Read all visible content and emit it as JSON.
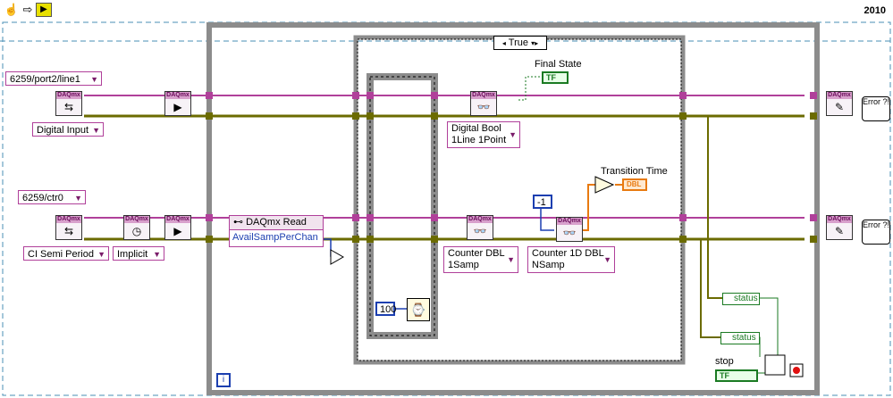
{
  "toolbar": {
    "icons": [
      "hand-icon",
      "arrow-right-icon",
      "run-arrow-icon"
    ],
    "version": "2010"
  },
  "diagram": {
    "case_selector": "True",
    "controls": {
      "line_channel": "6259/port2/line1",
      "ctr_channel": "6259/ctr0",
      "digital_input": "Digital Input",
      "ci_semi_period": "CI Semi Period",
      "implicit": "Implicit",
      "digital_bool_1": "Digital Bool",
      "digital_bool_2": "1Line 1Point",
      "counter_dbl_1": "Counter DBL",
      "counter_dbl_2": "1Samp",
      "counter_1d_dbl_1": "Counter 1D DBL",
      "counter_1d_dbl_2": "NSamp"
    },
    "read_node": {
      "title": "DAQmx Read",
      "property": "AvailSampPerChan"
    },
    "labels": {
      "final_state": "Final State",
      "transition_time": "Transition Time",
      "stop": "stop",
      "status_1": "status",
      "status_2": "status",
      "loop_index": "i"
    },
    "constants": {
      "wait_ms": "100",
      "minus_one": "-1"
    },
    "indicators": {
      "tf_final": "TF",
      "tf_stop": "TF",
      "dbl": "DBL"
    },
    "vi_labels": {
      "daqmx": "DAQmx",
      "error": "Error ?!"
    }
  },
  "colors": {
    "pink_wire": "#b0409a",
    "olive_wire": "#6b6b00",
    "orange_wire": "#e87a10",
    "blue_wire": "#1c3fb0",
    "green_wire": "#1a7a22",
    "dashed_border": "#4a8fb5",
    "frame_gray": "#8c8c8c"
  }
}
